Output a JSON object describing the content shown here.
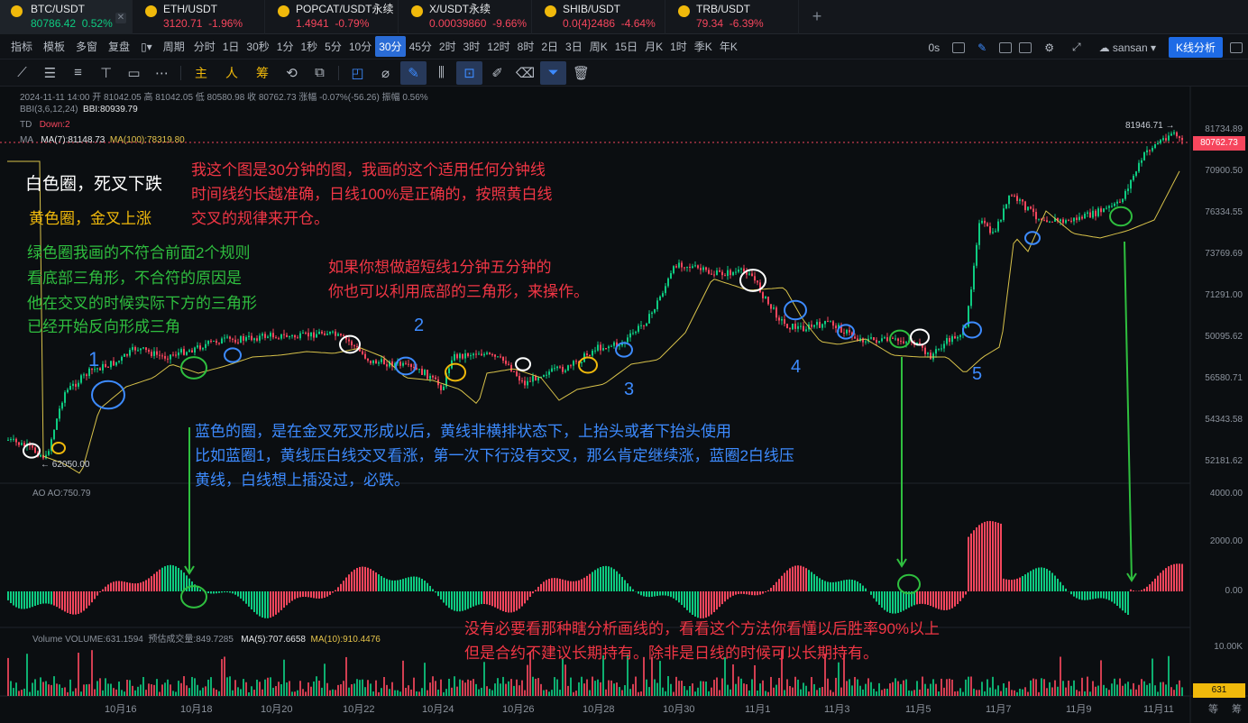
{
  "tabs": [
    {
      "symbol": "BTC/USDT",
      "price": "80786.42",
      "change": "0.52%",
      "dir": "up"
    },
    {
      "symbol": "ETH/USDT",
      "price": "3120.71",
      "change": "-1.96%",
      "dir": "dn"
    },
    {
      "symbol": "POPCAT/USDT永续",
      "price": "1.4941",
      "change": "-0.79%",
      "dir": "dn"
    },
    {
      "symbol": "X/USDT永续",
      "price": "0.00039860",
      "change": "-9.66%",
      "dir": "dn"
    },
    {
      "symbol": "SHIB/USDT",
      "price": "0.0{4}2486",
      "change": "-4.64%",
      "dir": "dn"
    },
    {
      "symbol": "TRB/USDT",
      "price": "79.34",
      "change": "-6.39%",
      "dir": "dn"
    }
  ],
  "toolbar": {
    "indicators": "指标",
    "template": "模板",
    "multi": "多窗",
    "replay": "复盘",
    "period_label": "周期",
    "periods": [
      "分时",
      "1日",
      "30秒",
      "1分",
      "1秒",
      "5分",
      "10分",
      "30分",
      "45分",
      "2时",
      "3时",
      "12时",
      "8时",
      "2日",
      "3日",
      "周K",
      "15日",
      "月K",
      "1时",
      "季K",
      "年K"
    ],
    "active_period": "30分",
    "countdown": "0s",
    "user": "sansan",
    "kline_analysis": "K线分析"
  },
  "drawbar": {
    "texts": [
      "主",
      "人",
      "筹"
    ]
  },
  "legend": {
    "ohlc": "2024-11-11 14:00 开 81042.05 高 81042.05 低 80580.98 收 80762.73 涨幅 -0.07%(-56.26) 振幅 0.56%",
    "bbi_label": "BBI(3,6,12,24)",
    "bbi_value": "BBI:80939.79",
    "td_label": "TD",
    "td_value": "Down:2",
    "ma_label": "MA",
    "ma7": "MA(7):81148.73",
    "ma100": "MA(100):78319.80",
    "ao": "AO  AO:750.79",
    "volume_label": "Volume  VOLUME:631.1594",
    "volume_est": "预估成交量:849.7285",
    "vol_ma5": "MA(5):707.6658",
    "vol_ma10": "MA(10):910.4476"
  },
  "notes": {
    "white_circle": "白色圈，死叉下跌",
    "yellow_circle": "黄色圈，金叉上涨",
    "green_1": "绿色圈我画的不符合前面2个规则",
    "green_2": "看底部三角形，不合符的原因是",
    "green_3": "他在交叉的时候实际下方的三角形",
    "green_4": "已经开始反向形成三角",
    "red_top_1": "我这个图是30分钟的图，我画的这个适用任何分钟线",
    "red_top_2": "时间线约长越准确，日线100%是正确的，按照黄白线",
    "red_top_3": "交叉的规律来开仓。",
    "red_mid_1": "如果你想做超短线1分钟五分钟的",
    "red_mid_2": "你也可以利用底部的三角形，来操作。",
    "blue_1": "蓝色的圈，是在金叉死叉形成以后，黄线非横排状态下，上抬头或者下抬头使用",
    "blue_2": "比如蓝圈1，黄线压白线交叉看涨，第一次下行没有交叉，那么肯定继续涨，蓝圈2白线压",
    "blue_3": "黄线，白线想上插没过，必跌。",
    "red_bottom_1": "没有必要看那种瞎分析画线的，看看这个方法你看懂以后胜率90%以上",
    "red_bottom_2": "但是合约不建议长期持有。除非是日线的时候可以长期持有。"
  },
  "price_axis": [
    "81734.89",
    "70900.50",
    "76334.55",
    "73769.69",
    "71291.00",
    "50095.62",
    "56580.71",
    "54343.58",
    "52181.62"
  ],
  "current_price": "80762.73",
  "ao_axis": [
    "4000.00",
    "2000.00",
    "0.00"
  ],
  "vol_axis": [
    "10.00K"
  ],
  "vol_current": "631",
  "min_price_label": "← 62050.00",
  "max_price_label": "81946.71 →",
  "x_labels": [
    "10月16",
    "10月18",
    "10月20",
    "10月22",
    "10月24",
    "10月26",
    "10月28",
    "10月30",
    "11月1",
    "11月3",
    "11月5",
    "11月7",
    "11月9",
    "11月11"
  ],
  "footer_glyphs": [
    "等",
    "筹"
  ],
  "circle_numbers": [
    "1",
    "2",
    "3",
    "4",
    "5"
  ],
  "colors": {
    "up": "#0ecb81",
    "down": "#f6465d",
    "ma_white": "#e6e8ea",
    "ma_yellow": "#d8c24a",
    "accent": "#1e6be6"
  }
}
